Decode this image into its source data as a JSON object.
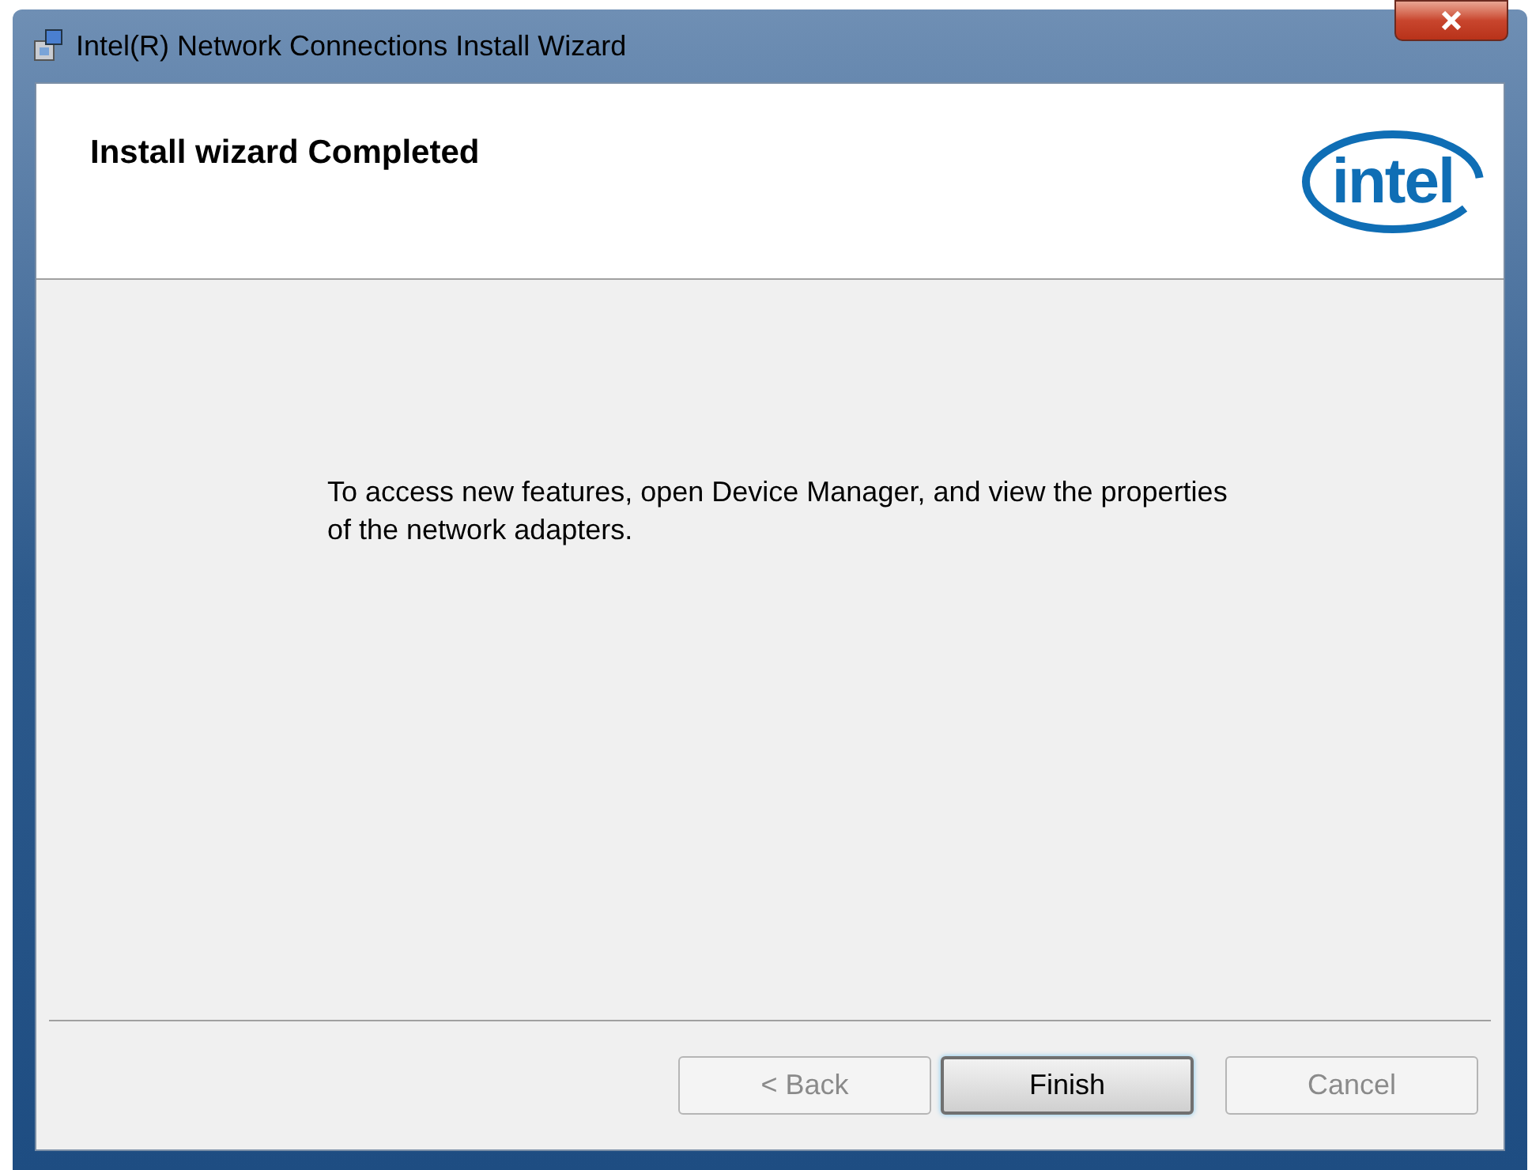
{
  "window": {
    "title": "Intel(R) Network Connections Install Wizard"
  },
  "header": {
    "title": "Install wizard Completed",
    "logo_text": "intel"
  },
  "message": "To access new features, open Device Manager, and view the properties of the network adapters.",
  "buttons": [
    {
      "label": "< Back",
      "disabled": true,
      "default": false
    },
    {
      "label": "Finish",
      "disabled": false,
      "default": true
    },
    {
      "label": "Cancel",
      "disabled": true,
      "default": false
    }
  ]
}
